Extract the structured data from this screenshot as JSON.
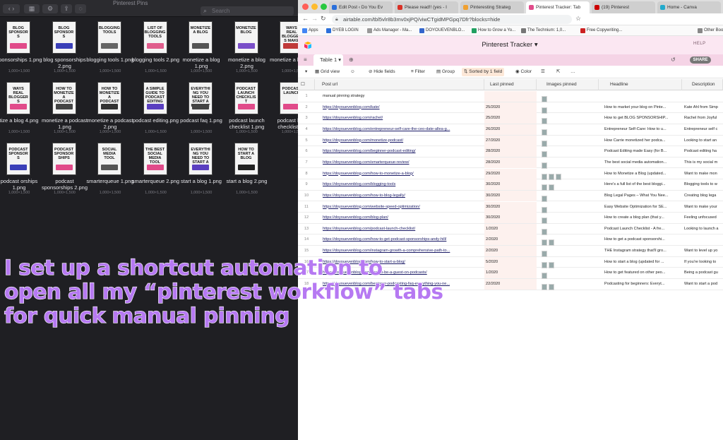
{
  "finder": {
    "title": "Pinterest Pins",
    "search_placeholder": "Search",
    "files": [
      {
        "name": "sponsorships 1.png",
        "size": "1,000×1,500",
        "thumb": "BLOG SPONSORS",
        "bar": "#e14b8a"
      },
      {
        "name": "blog sponsorships 2.png",
        "size": "1,000×1,500",
        "thumb": "BLOG SPONSORS",
        "bar": "#3a3fb8"
      },
      {
        "name": "blogging tools 1.png",
        "size": "1,000×1,500",
        "thumb": "BLOGGING TOOLS",
        "bar": "#666666"
      },
      {
        "name": "blogging tools 2.png",
        "size": "1,000×1,500",
        "thumb": "LIST OF BLOGGING TOOLS",
        "bar": "#e05d8c"
      },
      {
        "name": "monetize a blog 1.png",
        "size": "1,000×1,500",
        "thumb": "MONETIZE A BLOG",
        "bar": "#555555"
      },
      {
        "name": "monetize a blog 2.png",
        "size": "1,000×1,500",
        "thumb": "MONETIZE BLOG",
        "bar": "#7a4fc9"
      },
      {
        "name": "monetize a b 3.png",
        "size": "1,000×1,500",
        "thumb": "WAYS REAL BLOGGERS MAKE MONEY",
        "bar": "#c03a3a"
      },
      {
        "name": "tize a blog 4.png",
        "size": "1,000×1,500",
        "thumb": "WAYS REAL BLOGGERS",
        "bar": "#e14b8a"
      },
      {
        "name": "monetize a podcast 1.png",
        "size": "1,000×1,500",
        "thumb": "HOW TO MONETIZE A PODCAST",
        "bar": "#444444"
      },
      {
        "name": "monetize a podcast 2.png",
        "size": "1,000×1,500",
        "thumb": "HOW TO MONETIZE A PODCAST",
        "bar": "#333333"
      },
      {
        "name": "podcast editing.png",
        "size": "1,000×1,500",
        "thumb": "A SIMPLE GUIDE TO PODCAST EDITING",
        "bar": "#5a3fc0"
      },
      {
        "name": "podcast faq 1.png",
        "size": "1,000×1,500",
        "thumb": "EVERYTHING YOU NEED TO START A PODCAST",
        "bar": "#444444"
      },
      {
        "name": "podcast launch checklist 1.png",
        "size": "1,000×1,500",
        "thumb": "PODCAST LAUNCH CHECKLIST",
        "bar": "#e14b8a"
      },
      {
        "name": "podcast laun checklist 2.p",
        "size": "1,000×1,500",
        "thumb": "PODCAST LAUNCH",
        "bar": "#e14b8a"
      },
      {
        "name": "podcast orships 1.png",
        "size": "1,000×1,500",
        "thumb": "PODCAST SPONSORS",
        "bar": "#3a3fb8"
      },
      {
        "name": "podcast sponsorships 2.png",
        "size": "1,000×1,500",
        "thumb": "PODCAST SPONSORSHIPS",
        "bar": "#e14b8a"
      },
      {
        "name": "smarterqueue 1.png",
        "size": "1,000×1,500",
        "thumb": "SOCIAL MEDIA TOOL",
        "bar": "#555555"
      },
      {
        "name": "smarterqueue 2.png",
        "size": "1,000×1,500",
        "thumb": "THE BEST SOCIAL MEDIA TOOL",
        "bar": "#e14b8a"
      },
      {
        "name": "start a blog 1.png",
        "size": "1,000×1,500",
        "thumb": "EVERYTHING YOU NEED TO START A BLOG",
        "bar": "#5a3fc0"
      },
      {
        "name": "start a blog 2.png",
        "size": "1,000×1,500",
        "thumb": "HOW TO START A BLOG",
        "bar": "#222222"
      }
    ]
  },
  "browser": {
    "tabs": [
      {
        "label": "Edit Post ‹ Do You Ev",
        "color": "#2a6fdb"
      },
      {
        "label": "Please read!! (yes - I",
        "color": "#d93025"
      },
      {
        "label": "Pinteresting Strateg",
        "color": "#f0a030"
      },
      {
        "label": "Pinterest Tracker: Tab",
        "color": "#e14b8a",
        "active": true
      },
      {
        "label": "(19) Pinterest",
        "color": "#cc0000"
      },
      {
        "label": "Home - Canva",
        "color": "#22aacc"
      }
    ],
    "url": "airtable.com/tbl5vlr8b3mv0xjPQ/viwCTgidMPGpq7Dfr?blocks=hide",
    "bookmarks": [
      {
        "label": "Apps",
        "color": "#4285f4"
      },
      {
        "label": "DYEB LOGIN",
        "color": "#2a6fdb"
      },
      {
        "label": "Ads Manager - Ma...",
        "color": "#999999"
      },
      {
        "label": "DOYOUEVENBLO...",
        "color": "#3366cc"
      },
      {
        "label": "How to Grow a Yo...",
        "color": "#20a060"
      },
      {
        "label": "The Technium: 1,0...",
        "color": "#777777"
      },
      {
        "label": "Free Copywriting...",
        "color": "#cc2222"
      },
      {
        "label": "Other Boo",
        "color": "#888888"
      }
    ]
  },
  "airtable": {
    "base_title": "Pinterest Tracker",
    "help": "HELP",
    "share": "SHARE",
    "table_tab": "Table 1",
    "view": {
      "grid": "Grid view",
      "hide": "Hide fields",
      "filter": "Filter",
      "group": "Group",
      "sort": "Sorted by 1 field",
      "color": "Color"
    },
    "columns": [
      "Post url",
      "Last pinned",
      "Images pinned",
      "Headline",
      "Description"
    ],
    "rows": [
      {
        "n": "1",
        "url": "manual pinning strategy",
        "date": "",
        "imgs": 1,
        "headline": "",
        "desc": ""
      },
      {
        "n": "2",
        "url": "https://doyouevenblog.com/kate/",
        "date": "25/2020",
        "imgs": 1,
        "headline": "How to market your blog on Pinte...",
        "desc": "Kate Ahl from Simp"
      },
      {
        "n": "3",
        "url": "https://doyouevenblog.com/rachel/",
        "date": "25/2020",
        "imgs": 1,
        "headline": "How to get BLOG SPONSORSHIP...",
        "desc": "Rachel from Joyful"
      },
      {
        "n": "4",
        "url": "https://doyouevenblog.com/entrepreneur-self-care-the-ceo-date-allea-g...",
        "date": "26/2020",
        "imgs": 1,
        "headline": "Entrepreneur Self-Care: How to u...",
        "desc": "Entrepreneur self c"
      },
      {
        "n": "5",
        "url": "https://doyouevenblog.com/monetize-podcast/",
        "date": "27/2020",
        "imgs": 1,
        "headline": "How Carrie monetized her podca...",
        "desc": "Looking to start an"
      },
      {
        "n": "6",
        "url": "https://doyouevenblog.com/beginner-podcast-editing/",
        "date": "28/2020",
        "imgs": 1,
        "headline": "Podcast Editing made Easy (for B...",
        "desc": "Podcast editing ha"
      },
      {
        "n": "7",
        "url": "https://doyouevenblog.com/smarterqueue-review/",
        "date": "28/2020",
        "imgs": 1,
        "headline": "The best social media automation...",
        "desc": "This is my social m"
      },
      {
        "n": "8",
        "url": "https://doyouevenblog.com/how-to-monetize-a-blog/",
        "date": "29/2020",
        "imgs": 3,
        "headline": "How to Monetize a Blog (updated...",
        "desc": "Want to make mon"
      },
      {
        "n": "9",
        "url": "https://doyouevenblog.com/blogging-tools",
        "date": "30/2020",
        "imgs": 2,
        "headline": "Here's a full list of the best bloggi...",
        "desc": "Blogging tools to w"
      },
      {
        "n": "10",
        "url": "https://doyouevenblog.com/how-to-blog-legally/",
        "date": "30/2020",
        "imgs": 1,
        "headline": "Blog Legal Pages – What You Nee...",
        "desc": "Creating blog lega"
      },
      {
        "n": "11",
        "url": "https://doyouevenblog.com/website-speed-optimization/",
        "date": "30/2020",
        "imgs": 1,
        "headline": "Easy Website Optimization for SE...",
        "desc": "Want to make your"
      },
      {
        "n": "12",
        "url": "https://doyouevenblog.com/blog-plan/",
        "date": "30/2020",
        "imgs": 1,
        "headline": "How to create a blog plan (that y...",
        "desc": "Feeling unfocused"
      },
      {
        "n": "13",
        "url": "https://doyouevenblog.com/podcast-launch-checklist/",
        "date": "1/2020",
        "imgs": 1,
        "headline": "Podcast Launch Checklist - A fre...",
        "desc": "Looking to launch a"
      },
      {
        "n": "14",
        "url": "https://doyouevenblog.com/how-to-get-podcast-sponsorships-andy-hill/",
        "date": "2/2020",
        "imgs": 2,
        "headline": "How to get a podcast sponsorshi...",
        "desc": ""
      },
      {
        "n": "15",
        "url": "https://doyouevenblog.com/instagram-growth-a-comprehensive-path-to...",
        "date": "2/2020",
        "imgs": 1,
        "headline": "THE Instagram strategy that'll gro...",
        "desc": "Want to level up yo"
      },
      {
        "n": "16",
        "url": "https://doyouevenblog.com/how-to-start-a-blog/",
        "date": "5/2020",
        "imgs": 2,
        "headline": "How to start a blog (updated for ...",
        "desc": "If you're looking to"
      },
      {
        "n": "17",
        "url": "https://doyouevenblog.com/how-to-be-a-guest-on-podcasts/",
        "date": "1/2020",
        "imgs": 1,
        "headline": "How to get featured on other peo...",
        "desc": "Being a podcast gu"
      },
      {
        "n": "18",
        "url": "https://doyouevenblog.com/beginner-podcasting-faq-everything-you-ne...",
        "date": "22/2020",
        "imgs": 2,
        "headline": "Podcasting for beginners: Everyt...",
        "desc": "Want to start a pod"
      }
    ]
  },
  "caption": {
    "line1": "I set up a shortcut automation to",
    "line2": "open all my “pinterest workflow” tabs",
    "line3": "for quick manual pinning"
  },
  "colors": {
    "caption_fill": "#b679f2",
    "airtable_header": "#fbe7f2",
    "airtable_tables_bar": "#f5d4e6"
  }
}
